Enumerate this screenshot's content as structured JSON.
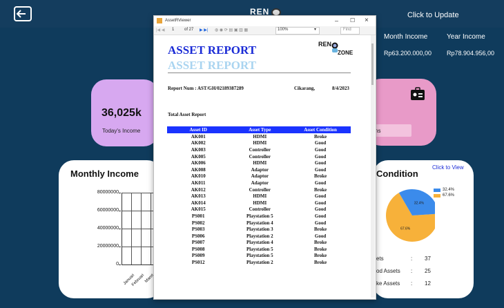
{
  "brand": "REN",
  "header": {
    "update_label": "Click to Update",
    "month_income_label": "Month Income",
    "year_income_label": "Year Income",
    "month_income_value": "Rp63.200.000,00",
    "year_income_value": "Rp78.904.956,00"
  },
  "stats": {
    "today_income_value": "36,025k",
    "today_income_label": "Today's Income",
    "right_card_text": "ns"
  },
  "monthly_income": {
    "title": "Monthly Income",
    "chart_data": {
      "type": "line",
      "ylim": [
        0,
        80000000
      ],
      "yticks": [
        "80000000",
        "60000000",
        "40000000",
        "20000000",
        "0"
      ],
      "categories": [
        "Januari",
        "Februari",
        "Maret"
      ]
    }
  },
  "condition": {
    "title": "Condition",
    "view_label": "Click to View",
    "chart_data": {
      "type": "pie",
      "values": [
        32.4,
        67.6
      ],
      "labels": [
        "32.4%",
        "67.6%"
      ],
      "colors": [
        "#3b8beb",
        "#f7b13a"
      ]
    },
    "legend": [
      "32.4%",
      "67.6%"
    ],
    "rows": [
      {
        "label": "ets",
        "sep": ":",
        "value": "37"
      },
      {
        "label": "od Assets",
        "sep": ":",
        "value": "25"
      },
      {
        "label": "ke Assets",
        "sep": ":",
        "value": "12"
      }
    ]
  },
  "viewer": {
    "window_title": "AssetRViewer",
    "toolbar": {
      "page": "1",
      "of_pages": "of 27",
      "zoom": "100%",
      "find": "Find"
    },
    "report": {
      "title": "ASSET REPORT",
      "title_shadow": "ASSET REPORT",
      "logo_text": "REN",
      "logo_sub": "ZONE",
      "report_num": "Report Num : AST/GH/02189387289",
      "city": "Cikarang,",
      "date": "8/4/2023",
      "section": "Total Asset Report",
      "columns": [
        "Asset ID",
        "Asset Type",
        "Asset Condition"
      ],
      "rows": [
        [
          "AK001",
          "HDMI",
          "Broke"
        ],
        [
          "AK002",
          "HDMI",
          "Good"
        ],
        [
          "AK003",
          "Controller",
          "Good"
        ],
        [
          "AK005",
          "Controller",
          "Good"
        ],
        [
          "AK006",
          "HDMI",
          "Good"
        ],
        [
          "AK008",
          "Adaptor",
          "Good"
        ],
        [
          "AK010",
          "Adaptor",
          "Broke"
        ],
        [
          "AK011",
          "Adaptor",
          "Good"
        ],
        [
          "AK012",
          "Controller",
          "Broke"
        ],
        [
          "AK013",
          "HDMI",
          "Good"
        ],
        [
          "AK014",
          "HDMI",
          "Good"
        ],
        [
          "AK015",
          "Controller",
          "Good"
        ],
        [
          "PS001",
          "Playstation 5",
          "Good"
        ],
        [
          "PS002",
          "Playstation 4",
          "Good"
        ],
        [
          "PS003",
          "Playstation 3",
          "Broke"
        ],
        [
          "PS006",
          "Playstation 2",
          "Good"
        ],
        [
          "PS007",
          "Playstation 4",
          "Broke"
        ],
        [
          "PS008",
          "Playstation 5",
          "Broke"
        ],
        [
          "PS009",
          "Playstation 5",
          "Broke"
        ],
        [
          "PS012",
          "Playstation 2",
          "Broke"
        ]
      ]
    }
  }
}
